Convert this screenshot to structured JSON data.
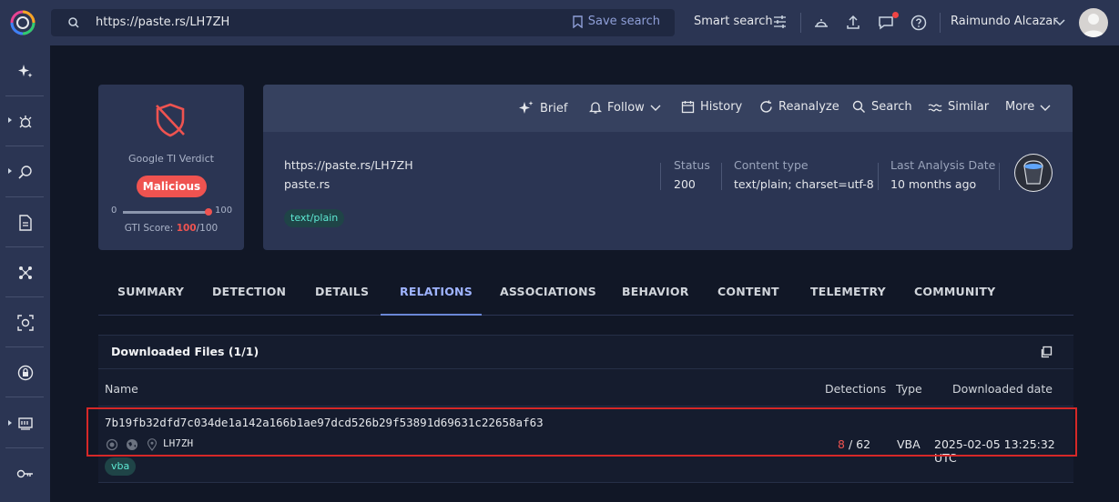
{
  "topbar": {
    "search_value": "https://paste.rs/LH7ZH",
    "save_search": "Save search",
    "smart_search": "Smart search",
    "user_name": "Raimundo Alcazar"
  },
  "sidebar": {
    "items": [
      "sparkles-icon",
      "threat-icon",
      "hunting-icon",
      "report-icon",
      "graph-icon",
      "scan-icon",
      "lock-icon",
      "terminal-icon",
      "key-icon"
    ]
  },
  "verdict": {
    "label": "Google TI Verdict",
    "badge": "Malicious",
    "range_min": "0",
    "range_max": "100",
    "score_label": "GTI Score: ",
    "score_value": "100",
    "score_total": "/100",
    "score_fraction": 1.0
  },
  "actions": {
    "brief": "Brief",
    "follow": "Follow",
    "history": "History",
    "reanalyze": "Reanalyze",
    "search": "Search",
    "similar": "Similar",
    "more": "More"
  },
  "info": {
    "url": "https://paste.rs/LH7ZH",
    "host": "paste.rs",
    "tag": "text/plain",
    "status_label": "Status",
    "status_value": "200",
    "content_type_label": "Content type",
    "content_type_value": "text/plain; charset=utf-8",
    "last_analysis_label": "Last Analysis Date",
    "last_analysis_value": "10 months ago"
  },
  "tabs": [
    "SUMMARY",
    "DETECTION",
    "DETAILS",
    "RELATIONS",
    "ASSOCIATIONS",
    "BEHAVIOR",
    "CONTENT",
    "TELEMETRY",
    "COMMUNITY"
  ],
  "active_tab": "RELATIONS",
  "relations": {
    "title": "Downloaded Files (1/1)",
    "columns": {
      "name": "Name",
      "detections": "Detections",
      "type": "Type",
      "downloaded": "Downloaded date"
    },
    "row": {
      "hash": "7b19fb32dfd7c034de1a142a166b1ae97dcd526b29f53891d69631c22658af63",
      "file_name": "LH7ZH",
      "detections_positive": "8",
      "detections_total": "/ 62",
      "type": "VBA",
      "date": "2025-02-05 13:25:32 UTC",
      "tag": "vba"
    }
  },
  "colors": {
    "accent": "#6b87d6",
    "malicious": "#ef5350",
    "highlight": "#d62828"
  }
}
